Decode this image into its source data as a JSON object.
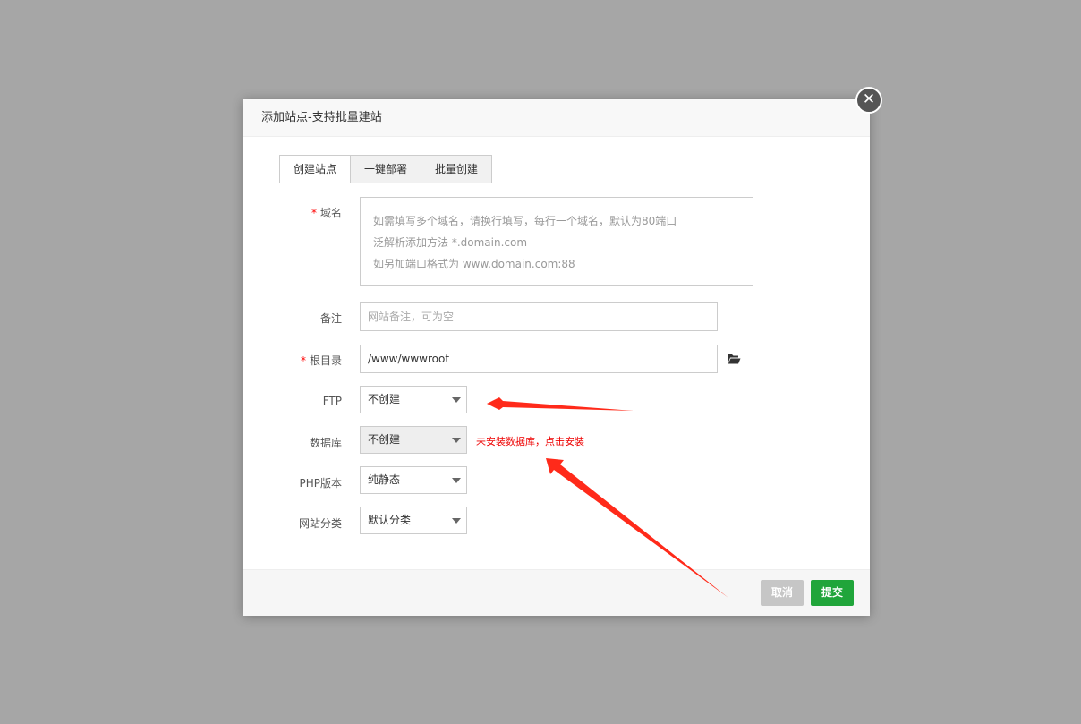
{
  "dialog": {
    "title": "添加站点-支持批量建站",
    "close_symbol": "✕"
  },
  "tabs": [
    {
      "label": "创建站点",
      "active": true
    },
    {
      "label": "一键部署",
      "active": false
    },
    {
      "label": "批量创建",
      "active": false
    }
  ],
  "form": {
    "required_mark": "*",
    "domain": {
      "label": "域名",
      "placeholder_lines": [
        "如需填写多个域名，请换行填写，每行一个域名，默认为80端口",
        "泛解析添加方法 *.domain.com",
        "如另加端口格式为 www.domain.com:88"
      ]
    },
    "remark": {
      "label": "备注",
      "placeholder": "网站备注，可为空"
    },
    "root": {
      "label": "根目录",
      "value": "/www/wwwroot",
      "icon": "folder-open-icon"
    },
    "ftp": {
      "label": "FTP",
      "value": "不创建"
    },
    "database": {
      "label": "数据库",
      "value": "不创建",
      "tip": "未安装数据库，点击安装"
    },
    "php": {
      "label": "PHP版本",
      "value": "纯静态"
    },
    "category": {
      "label": "网站分类",
      "value": "默认分类"
    }
  },
  "footer": {
    "cancel_label": "取消",
    "submit_label": "提交"
  },
  "colors": {
    "accent": "#20a53a",
    "annotation_arrow": "#ff2a1a",
    "error_text": "#e00000"
  }
}
